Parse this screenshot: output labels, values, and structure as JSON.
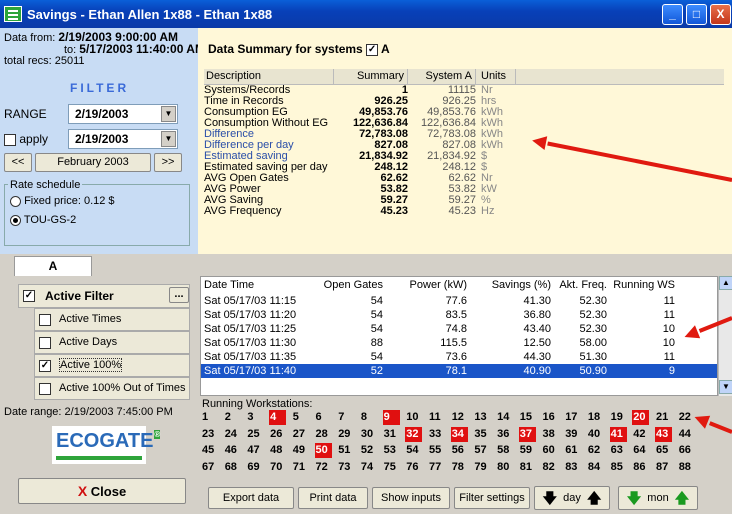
{
  "window": {
    "title": "Savings - Ethan Allen 1x88 - Ethan 1x88",
    "min": "_",
    "max": "□",
    "close": "X"
  },
  "info": {
    "data_from_label": "Data from:",
    "data_from": "2/19/2003 9:00:00 AM",
    "to_label": "to:",
    "to": "5/17/2003 11:40:00 AM",
    "total_recs": "total recs: 25011"
  },
  "filter": {
    "heading": "FILTER",
    "range_label": "RANGE",
    "range_value": "2/19/2003",
    "apply_label": "apply",
    "apply_value": "2/19/2003",
    "prev": "<<",
    "month": "February 2003",
    "next": ">>"
  },
  "rate": {
    "legend": "Rate schedule",
    "fixed_label": "Fixed price: 0.12 $",
    "tou_label": "TOU-GS-2"
  },
  "summary": {
    "title": "Data Summary for systems",
    "system_checkbox": "✓",
    "system_label": "A",
    "headers": [
      "Description",
      "Summary",
      "System A",
      "Units"
    ],
    "rows": [
      {
        "d": "Systems/Records",
        "s": "1",
        "a": "11115",
        "u": "Nr",
        "blue": false
      },
      {
        "d": "Time in Records",
        "s": "926.25",
        "a": "926.25",
        "u": "hrs",
        "blue": false
      },
      {
        "d": "Consumption EG",
        "s": "49,853.76",
        "a": "49,853.76",
        "u": "kWh",
        "blue": false
      },
      {
        "d": "Consumption Without EG",
        "s": "122,636.84",
        "a": "122,636.84",
        "u": "kWh",
        "blue": false
      },
      {
        "d": "Difference",
        "s": "72,783.08",
        "a": "72,783.08",
        "u": "kWh",
        "blue": true
      },
      {
        "d": "Difference per day",
        "s": "827.08",
        "a": "827.08",
        "u": "kWh",
        "blue": true
      },
      {
        "d": "Estimated saving",
        "s": "21,834.92",
        "a": "21,834.92",
        "u": "$",
        "blue": true
      },
      {
        "d": "Estimated saving per day",
        "s": "248.12",
        "a": "248.12",
        "u": "$",
        "blue": false
      },
      {
        "d": "AVG Open Gates",
        "s": "62.62",
        "a": "62.62",
        "u": "Nr",
        "blue": false
      },
      {
        "d": "AVG Power",
        "s": "53.82",
        "a": "53.82",
        "u": "kW",
        "blue": false
      },
      {
        "d": "AVG Saving",
        "s": "59.27",
        "a": "59.27",
        "u": "%",
        "blue": false
      },
      {
        "d": "AVG Frequency",
        "s": "45.23",
        "a": "45.23",
        "u": "Hz",
        "blue": false
      }
    ]
  },
  "tab": {
    "label": "A"
  },
  "filters": {
    "active_filter": "Active Filter",
    "more": "...",
    "active_times": "Active Times",
    "active_days": "Active Days",
    "active_100": "Active 100%",
    "active_100_out": "Active 100% Out of Times",
    "date_range": "Date range: 2/19/2003 7:45:00 PM",
    "check": "✓"
  },
  "logo": {
    "text": "ECOGATE",
    "tm": "®"
  },
  "close_button": {
    "icon": "X",
    "label": "Close"
  },
  "grid": {
    "headers": [
      "Date Time",
      "Open Gates",
      "Power (kW)",
      "Savings (%)",
      "Akt. Freq.",
      "Running WS"
    ],
    "rows": [
      [
        "Sat 05/17/03 11:15",
        "54",
        "77.6",
        "41.30",
        "52.30",
        "11"
      ],
      [
        "Sat 05/17/03 11:20",
        "54",
        "83.5",
        "36.80",
        "52.30",
        "11"
      ],
      [
        "Sat 05/17/03 11:25",
        "54",
        "74.8",
        "43.40",
        "52.30",
        "10"
      ],
      [
        "Sat 05/17/03 11:30",
        "88",
        "115.5",
        "12.50",
        "58.00",
        "10"
      ],
      [
        "Sat 05/17/03 11:35",
        "54",
        "73.6",
        "44.30",
        "51.30",
        "11"
      ],
      [
        "Sat 05/17/03 11:40",
        "52",
        "78.1",
        "40.90",
        "50.90",
        "9"
      ]
    ],
    "selected_row": 5
  },
  "workstations": {
    "label": "Running Workstations:",
    "count": 88,
    "per_row": 22,
    "active": [
      4,
      9,
      20,
      32,
      34,
      37,
      41,
      43,
      50
    ]
  },
  "toolbar": {
    "export": "Export data",
    "print": "Print data",
    "show_inputs": "Show inputs",
    "filter_settings": "Filter settings",
    "day": "day",
    "mon": "mon",
    "down": "🡇",
    "up": "🡅"
  },
  "colors": {
    "accent": "#e01010",
    "selection": "#1a55c8",
    "titlebar": "#0a4fc8",
    "summary_bg": "#fff8d8",
    "left_bg": "#c8dcf4"
  }
}
